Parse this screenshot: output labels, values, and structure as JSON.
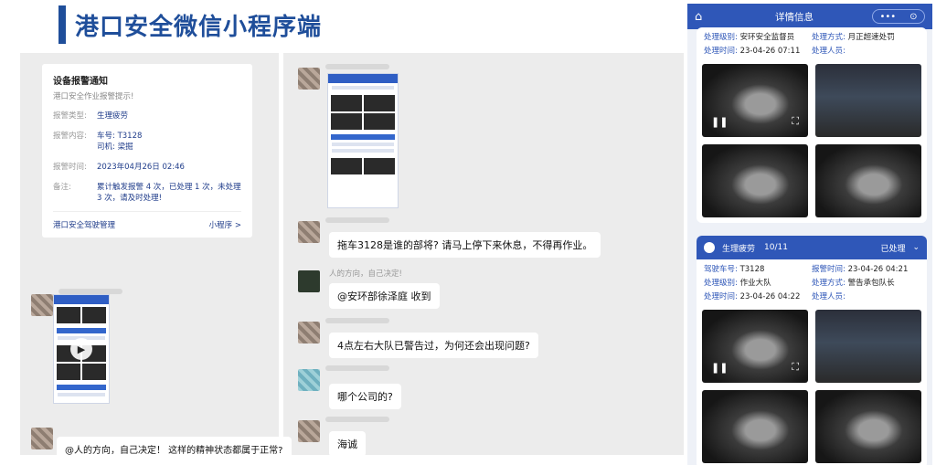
{
  "page_title": "港口安全微信小程序端",
  "notice": {
    "title": "设备报警通知",
    "subtitle": "港口安全作业报警提示!",
    "rows": [
      {
        "k": "报警类型:",
        "v": "生理疲劳"
      },
      {
        "k": "报警内容:",
        "v": "车号: T3128\n司机: 梁掘"
      },
      {
        "k": "报警时间:",
        "v": "2023年04月26日 02:46"
      },
      {
        "k": "备注:",
        "v": "累计触发报警 4 次，已处理 1 次，未处理 3 次，请及时处理!"
      }
    ],
    "footer_left": "港口安全驾驶管理",
    "footer_right": "小程序 >"
  },
  "chat": {
    "quote_top": "人的方向，自己决定!",
    "messages": [
      "拖车3128是谁的部将? 请马上停下来休息，不得再作业。",
      "@安环部徐泽庭 收到",
      "4点左右大队已警告过，为何还会出现问题?",
      "哪个公司的?",
      "海诚"
    ],
    "left_message": "@人的方向，自己决定！ 这样的精神状态都属于正常?"
  },
  "phone": {
    "header_title": "详情信息",
    "capsule_more": "•••",
    "capsule_close": "⊙",
    "card1": {
      "rows": [
        {
          "label": "处理级别:",
          "value": "安环安全监督员",
          "label2": "处理方式:",
          "value2": "月正超速处罚"
        },
        {
          "label": "处理时间:",
          "value": "23-04-26 07:11",
          "label2": "处理人员:",
          "value2": ""
        }
      ]
    },
    "card2": {
      "type": "生理疲劳",
      "count": "10/11",
      "status": "已处理",
      "rows": [
        {
          "label": "驾驶车号:",
          "value": "T3128",
          "label2": "报警时间:",
          "value2": "23-04-26 04:21"
        },
        {
          "label": "处理级别:",
          "value": "作业大队",
          "label2": "处理方式:",
          "value2": "警告承包队长"
        },
        {
          "label": "处理时间:",
          "value": "23-04-26 04:22",
          "label2": "处理人员:",
          "value2": ""
        }
      ]
    }
  },
  "colors": {
    "brand": "#1f4e9a",
    "phone_blue": "#2f57b8"
  }
}
